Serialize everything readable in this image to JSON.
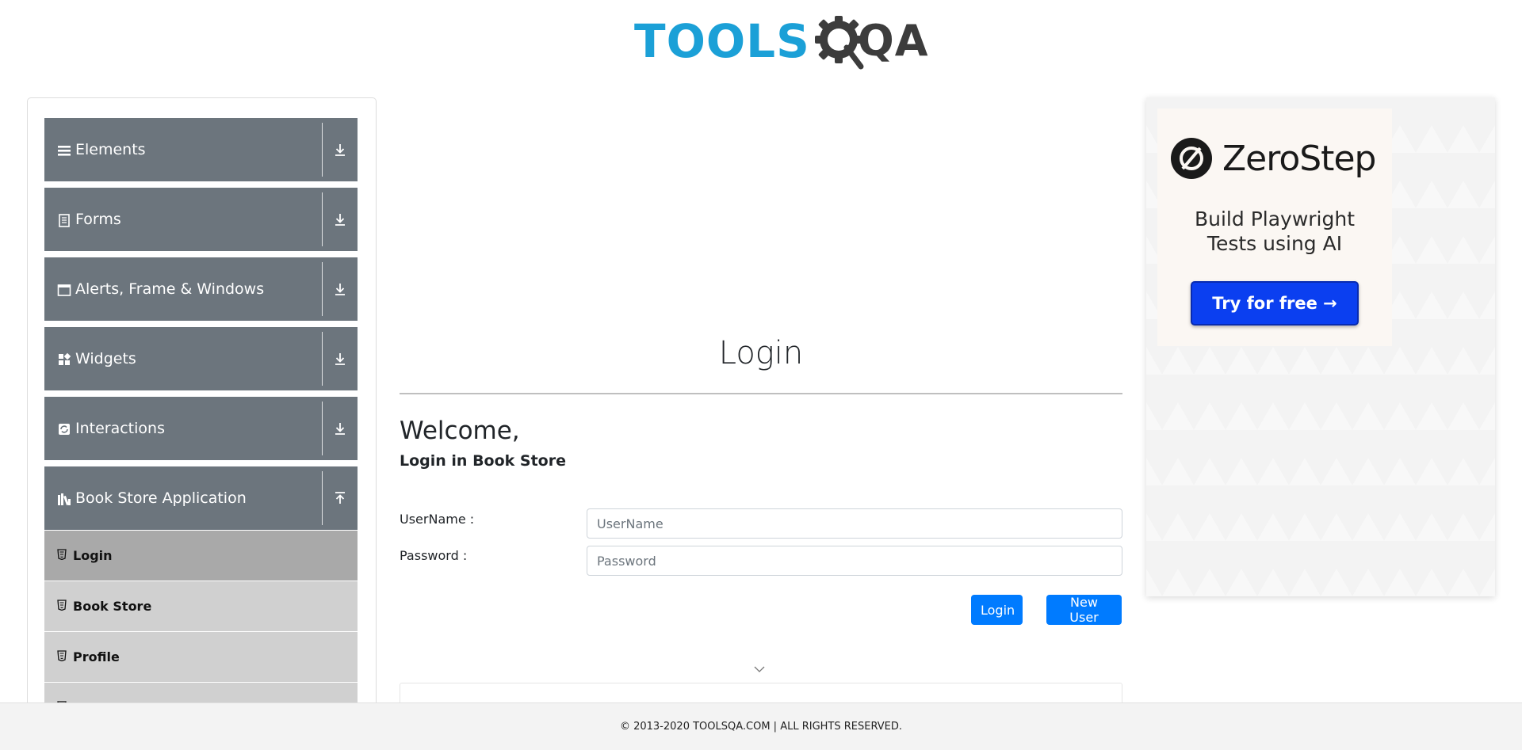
{
  "header": {
    "logo_tools": "TOOLS",
    "logo_qa": "QA",
    "colors": {
      "tools": "#1ba0d7",
      "qa": "#3c3c3c"
    }
  },
  "sidebar": {
    "groups": [
      {
        "title": "Elements",
        "icon": "hamburger-icon",
        "arrow": "download-arrow-icon"
      },
      {
        "title": "Forms",
        "icon": "document-icon",
        "arrow": "download-arrow-icon"
      },
      {
        "title": "Alerts, Frame & Windows",
        "icon": "window-icon",
        "arrow": "download-arrow-icon"
      },
      {
        "title": "Widgets",
        "icon": "grid-icon",
        "arrow": "download-arrow-icon"
      },
      {
        "title": "Interactions",
        "icon": "refresh-icon",
        "arrow": "download-arrow-icon"
      },
      {
        "title": "Book Store Application",
        "icon": "books-icon",
        "arrow": "upload-arrow-icon"
      }
    ],
    "book_store_items": [
      {
        "label": "Login",
        "active": true
      },
      {
        "label": "Book Store",
        "active": false
      },
      {
        "label": "Profile",
        "active": false
      }
    ],
    "colors": {
      "group_bg": "#6c757d",
      "item_bg": "#d0d0d0",
      "item_active_bg": "#a9a9a9"
    }
  },
  "main": {
    "title": "Login",
    "welcome": "Welcome,",
    "subtitle": "Login in Book Store",
    "username_label": "UserName :",
    "username_placeholder": "UserName",
    "password_label": "Password :",
    "password_placeholder": "Password",
    "login_button": "Login",
    "new_user_button": "New User",
    "colors": {
      "button": "#007bff"
    }
  },
  "ad": {
    "brand": "ZeroStep",
    "tagline_line1": "Build Playwright",
    "tagline_line2": "Tests using AI",
    "cta": "Try for free →",
    "colors": {
      "cta": "#0b3ff0"
    }
  },
  "footer": {
    "text": "© 2013-2020 TOOLSQA.COM | ALL RIGHTS RESERVED."
  }
}
